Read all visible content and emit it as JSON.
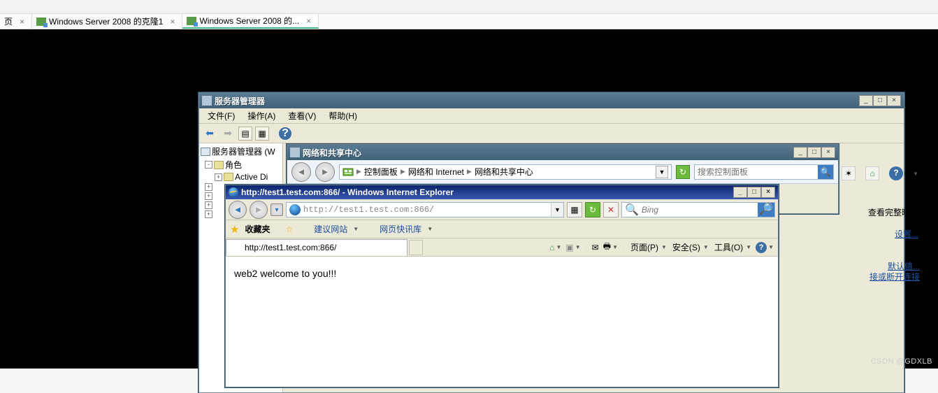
{
  "host": {
    "tabs": [
      {
        "label": "页"
      },
      {
        "label": "Windows Server 2008 的克隆1"
      },
      {
        "label": "Windows Server 2008 的..."
      }
    ]
  },
  "serverManager": {
    "title": "服务器管理器",
    "menu": {
      "file": "文件(F)",
      "action": "操作(A)",
      "view": "查看(V)",
      "help": "帮助(H)"
    },
    "tree": {
      "root": "服务器管理器 (W",
      "roles": "角色",
      "item1": "Active Di"
    }
  },
  "controlPanel": {
    "title": "网络和共享中心",
    "path": {
      "p1": "控制面板",
      "p2": "网络和 Internet",
      "p3": "网络和共享中心"
    },
    "searchPlaceholder": "搜索控制面板"
  },
  "ie": {
    "title": "http://test1.test.com:866/ - Windows Internet Explorer",
    "url": "http://test1.test.com:866/",
    "searchProvider": "Bing",
    "favorites": {
      "label": "收藏夹",
      "suggested": "建议网站",
      "slice": "网页快讯库"
    },
    "tabLabel": "http://test1.test.com:866/",
    "cmd": {
      "page": "页面(P)",
      "safety": "安全(S)",
      "tools": "工具(O)"
    },
    "content": "web2 welcome to you!!!"
  },
  "fragments": {
    "f1": "查看完整映射",
    "f2": "设置...",
    "f3": "默认值...",
    "f4": "接或断开连接"
  },
  "watermark": "CSDN @GDXLB"
}
